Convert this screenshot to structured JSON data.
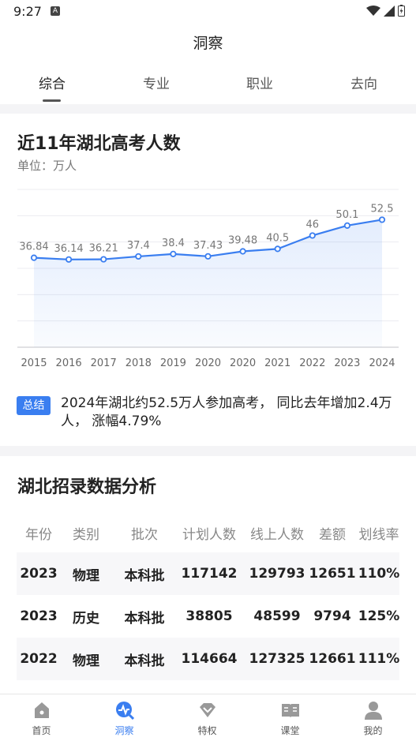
{
  "status": {
    "time": "9:27",
    "notif": "A"
  },
  "app_title": "洞察",
  "tabs": [
    {
      "label": "综合",
      "active": true
    },
    {
      "label": "专业",
      "active": false
    },
    {
      "label": "职业",
      "active": false
    },
    {
      "label": "去向",
      "active": false
    }
  ],
  "chart_section": {
    "title": "近11年湖北高考人数",
    "unit": "单位：万人"
  },
  "chart_data": {
    "type": "area",
    "title": "近11年湖北高考人数",
    "subtitle": "单位：万人",
    "categories": [
      "2015",
      "2016",
      "2017",
      "2018",
      "2019",
      "2020",
      "2020",
      "2021",
      "2022",
      "2023",
      "2024"
    ],
    "values": [
      36.84,
      36.14,
      36.21,
      37.4,
      38.4,
      37.43,
      39.48,
      40.5,
      46,
      50.1,
      52.5
    ],
    "value_labels": [
      "36.84",
      "36.14",
      "36.21",
      "37.4",
      "38.4",
      "37.43",
      "39.48",
      "40.5",
      "46",
      "50.1",
      "52.5"
    ],
    "ylim": [
      0,
      65
    ],
    "grid": true,
    "color": "#3a7ef0"
  },
  "summary": {
    "badge": "总结",
    "text": "2024年湖北约52.5万人参加高考， 同比去年增加2.4万人， 涨幅4.79%"
  },
  "table_section": {
    "title": "湖北招录数据分析",
    "headers": [
      "年份",
      "类别",
      "批次",
      "计划人数",
      "线上人数",
      "差额",
      "划线率"
    ],
    "rows": [
      [
        "2023",
        "物理",
        "本科批",
        "117142",
        "129793",
        "12651",
        "110%"
      ],
      [
        "2023",
        "历史",
        "本科批",
        "38805",
        "48599",
        "9794",
        "125%"
      ],
      [
        "2022",
        "物理",
        "本科批",
        "114664",
        "127325",
        "12661",
        "111%"
      ]
    ]
  },
  "bottom_nav": [
    {
      "label": "首页",
      "icon": "home-icon",
      "active": false
    },
    {
      "label": "洞察",
      "icon": "insight-icon",
      "active": true
    },
    {
      "label": "特权",
      "icon": "diamond-icon",
      "active": false
    },
    {
      "label": "课堂",
      "icon": "book-icon",
      "active": false
    },
    {
      "label": "我的",
      "icon": "person-icon",
      "active": false
    }
  ],
  "colors": {
    "accent": "#3a7ef0",
    "divider": "#f4f4f6"
  }
}
